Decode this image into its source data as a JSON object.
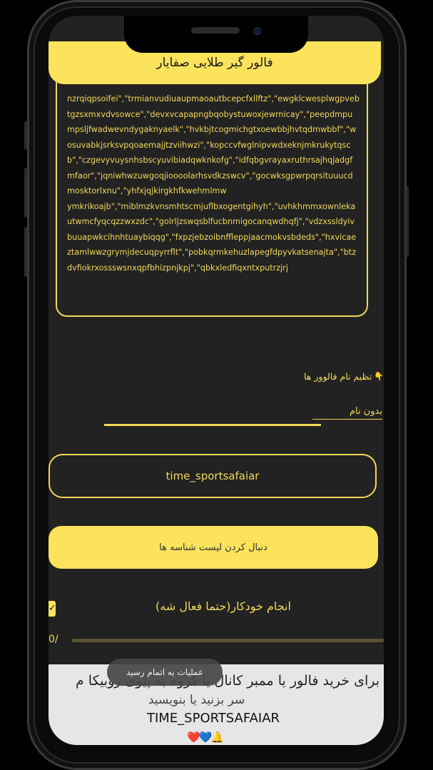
{
  "header": {
    "title": "فالور گیر طلایی صفایار"
  },
  "ids_list": {
    "text": "nzrqiqpsoifei\",\"trmianvudiuaupmaoautbcepcfxllftz\",\"ewgklcwesplwgpvebtgzsxmxvdvsowce\",\"devxvcapapngbqobystuwoxjewrnicay\",\"peepdmpumpsljfwadwevndygaknyaelk\",\"hvkbjtcogmichgtxoewbbjhvtqdmwbbf\",\"wosuvabkjsrksvpqoaemajjtzviihwzi\",\"kopccvfwglnipvwdxeknjmkrukytqscb\",\"czgevyvuysnhsbscyuvibiadqwknkofg\",\"idfqbgvrayaxruthrsajhqjadgfmfaor\",\"jqniwhwzuwgoqjioooolarhsvdkzswcv\",\"gocwksgpwrpqrsituuucdmosktorlxnu\",\"yhfxjqjkirgkhfkwehmlmw\nymkrikoajb\",\"miblmzkvnsmhtscmjuflbxogentgihyh\",\"uvhkhmmxownlekautwmcfyqcqzzwxzdc\",\"golrljzswqsblfucbnmigocanqwdhqfj\",\"vdzxssldyivbuuapwkcihnhtuaybiqqg\",\"fxpzjebzoibnffleppjaacmokvsbdeds\",\"hxvicaeztamlwwzgrymjdecuqpyrrflt\",\"pobkqrmkehuzlapegfdpyvkatsenajta\",\"btzdvfiokrxossswsnxqpfbhizpnjkpj\",\"qbkxledfiqxntxputrzjrj"
  },
  "name_settings": {
    "label": "تظیم نام فالوور ها",
    "icon": "pointing-down-hand-icon",
    "input_placeholder": "بدون نام",
    "input_value": ""
  },
  "channel": {
    "value": "time_sportsafaiar"
  },
  "follow_button": {
    "label": "دنبال کردن لیست شناسه ها"
  },
  "auto": {
    "label": "انجام خودکار(حتما فعال شه)",
    "checked": true
  },
  "progress": {
    "text": "0/",
    "value": 0
  },
  "footer": {
    "message": "برای خرید فالور یا ممبر کانال یا گروه به پیوی روبیکا م",
    "message2": "سر بزنید یا بنویسید",
    "channel": "TIME_SPORTSAFAIAR",
    "emojis": "❤️💙🔔"
  },
  "toast": {
    "text": "عملیات به اتمام رسید"
  },
  "colors": {
    "accent": "#fbe35c",
    "text_yellow": "#f2d85a",
    "background": "#222222"
  }
}
